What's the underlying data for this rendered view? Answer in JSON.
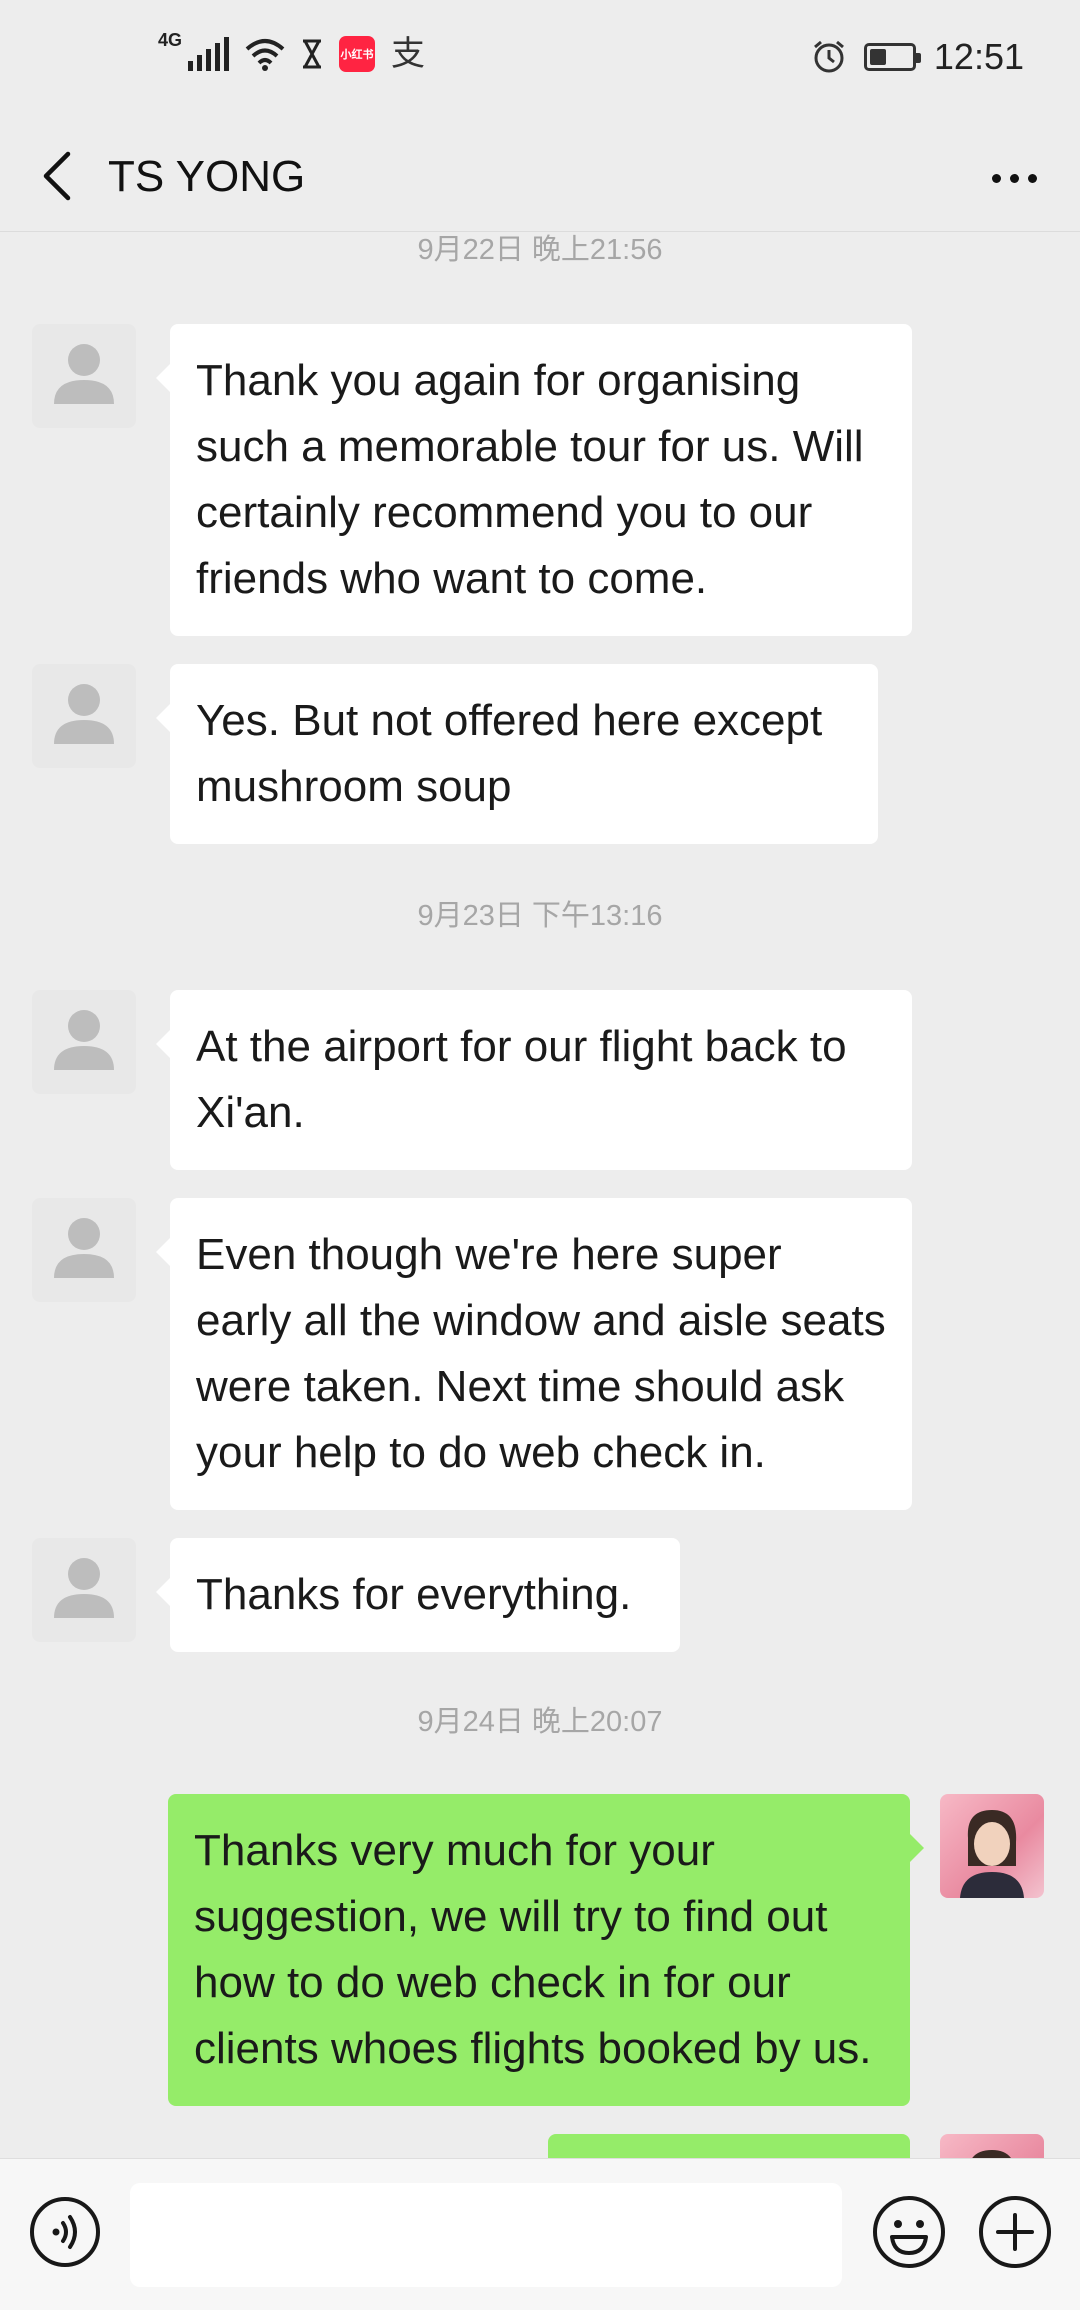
{
  "status_bar": {
    "network": "4G",
    "app_icon_label": "小红书",
    "alipay_glyph": "支",
    "time": "12:51",
    "battery_level": 0.35
  },
  "header": {
    "title": "TS YONG",
    "back_icon": "chevron-left-icon",
    "more_icon": "more-dots-icon"
  },
  "chat": {
    "timestamps": [
      "9月22日 晚上21:56",
      "9月23日 下午13:16",
      "9月24日 晚上20:07"
    ],
    "messages": [
      {
        "from": "TS YONG",
        "text": "Thank you again for organising such a memorable tour for us. Will certainly recommend you to our friends who want to come."
      },
      {
        "from": "TS YONG",
        "text": "Yes. But not offered here except mushroom soup"
      },
      {
        "from": "TS YONG",
        "text": "At the airport for our flight back to Xi'an."
      },
      {
        "from": "TS YONG",
        "text": "Even though we're here super early all the window and aisle seats were taken. Next time should ask your help to do web check in."
      },
      {
        "from": "TS YONG",
        "text": "Thanks for everything."
      },
      {
        "from": "me",
        "text": "Thanks very much for your suggestion, we will try to find out how to do web check in for our clients whoes flights booked by us."
      },
      {
        "from": "me",
        "text": ""
      }
    ]
  },
  "input_bar": {
    "voice_icon": "voice-icon",
    "text_value": "",
    "emoji_icon": "emoji-icon",
    "plus_icon": "plus-icon"
  },
  "colors": {
    "background": "#ededed",
    "incoming_bubble": "#ffffff",
    "outgoing_bubble": "#95ec69",
    "timestamp": "#a6a6a6"
  }
}
